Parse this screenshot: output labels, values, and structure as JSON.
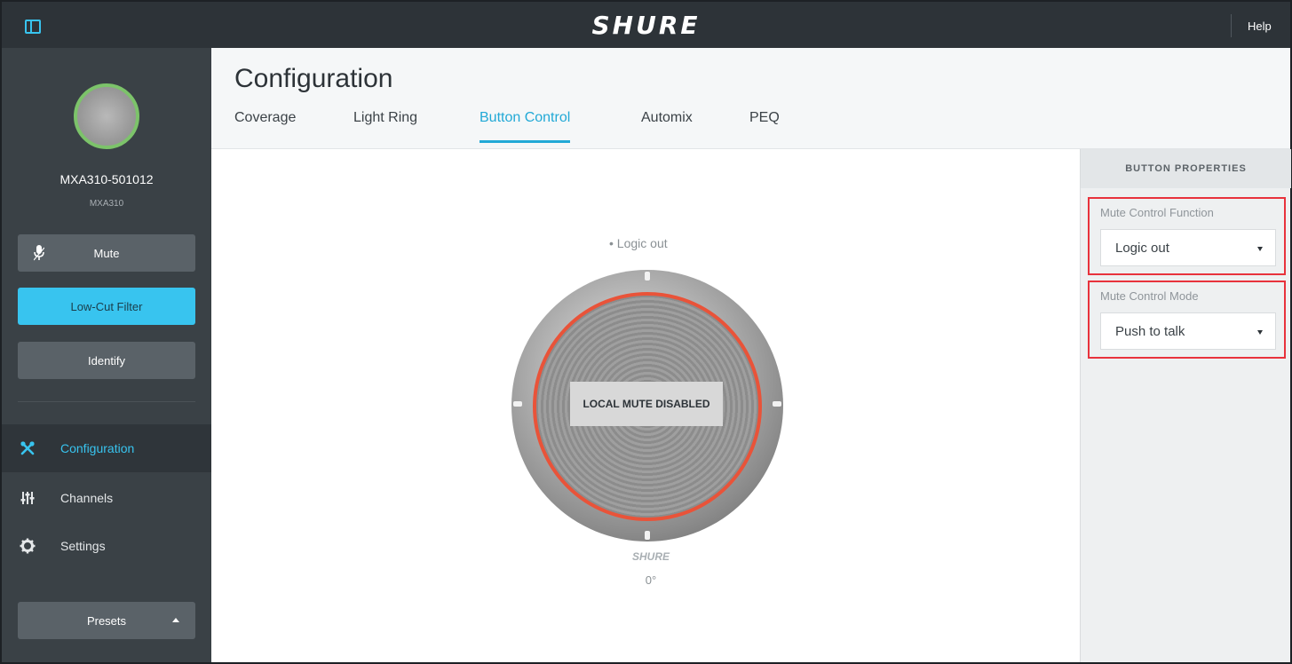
{
  "topbar": {
    "brand": "SHURE",
    "help": "Help"
  },
  "sidebar": {
    "device_name": "MXA310-501012",
    "device_model": "MXA310",
    "buttons": {
      "mute": "Mute",
      "low_cut": "Low-Cut Filter",
      "identify": "Identify",
      "presets": "Presets"
    },
    "nav": [
      {
        "label": "Configuration",
        "icon": "tools-icon",
        "active": true
      },
      {
        "label": "Channels",
        "icon": "sliders-icon",
        "active": false
      },
      {
        "label": "Settings",
        "icon": "gear-icon",
        "active": false
      }
    ]
  },
  "header": {
    "title": "Configuration",
    "tabs": [
      "Coverage",
      "Light Ring",
      "Button Control",
      "Automix",
      "PEQ"
    ],
    "active_tab": "Button Control"
  },
  "canvas": {
    "logic_label": "Logic out",
    "mute_status": "LOCAL MUTE DISABLED",
    "device_logo": "SHURE",
    "angle": "0°",
    "ring_color": "#e95339"
  },
  "properties": {
    "heading": "BUTTON PROPERTIES",
    "mute_control_function": {
      "label": "Mute Control Function",
      "value": "Logic out"
    },
    "mute_control_mode": {
      "label": "Mute Control Mode",
      "value": "Push to talk"
    }
  },
  "colors": {
    "accent": "#38c4ef",
    "highlight_box": "#e8323c",
    "status_ok": "#7cc36a"
  }
}
